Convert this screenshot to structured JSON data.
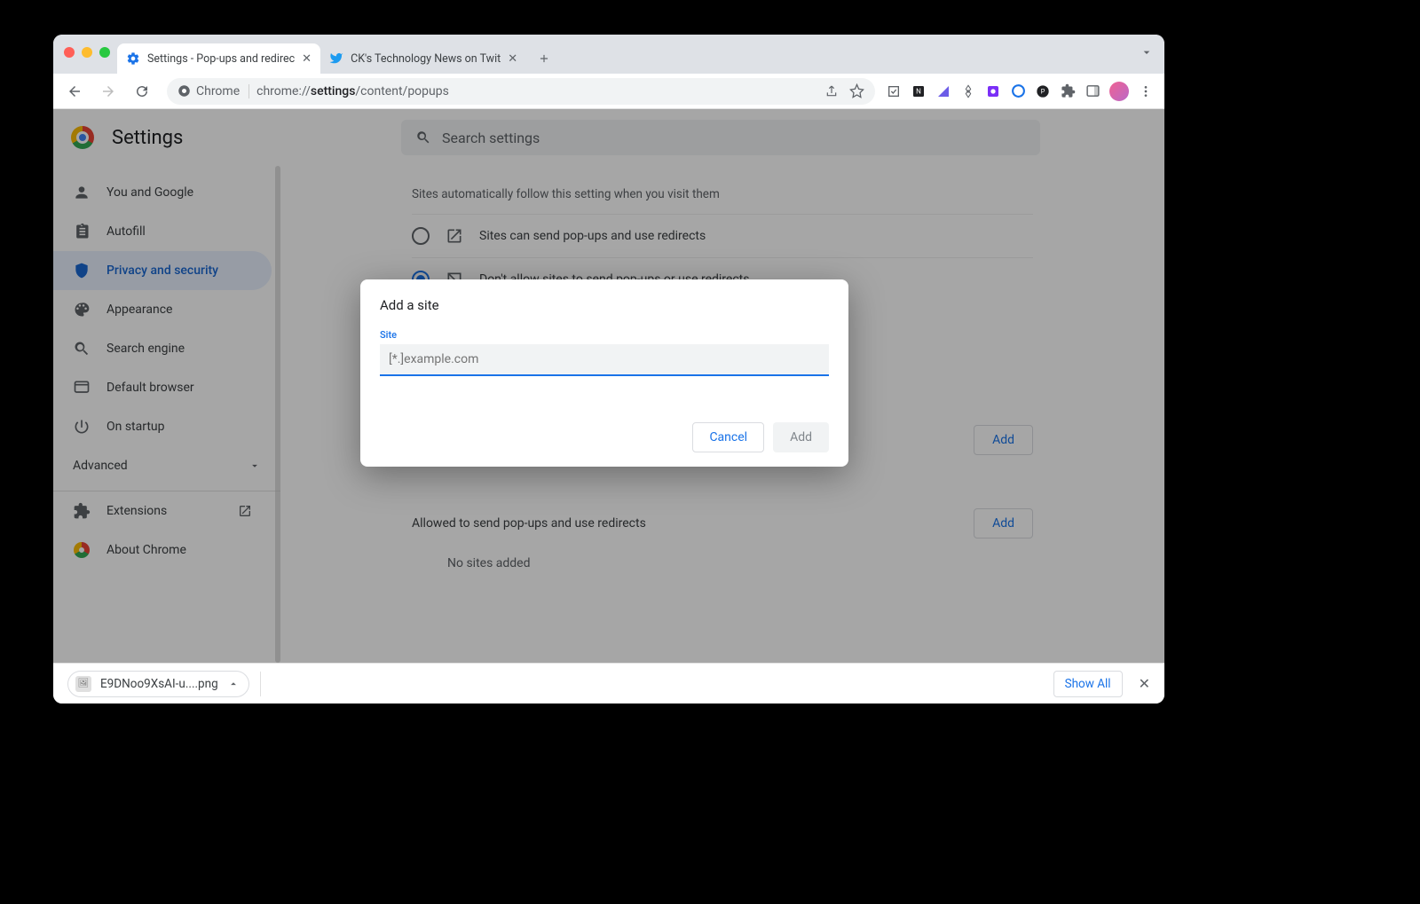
{
  "tabs": [
    {
      "title": "Settings - Pop-ups and redirec"
    },
    {
      "title": "CK's Technology News on Twit"
    }
  ],
  "omnibox": {
    "chip": "Chrome",
    "url_prefix": "chrome://",
    "url_bold": "settings",
    "url_suffix": "/content/popups"
  },
  "settings_header": {
    "title": "Settings",
    "search_placeholder": "Search settings"
  },
  "sidebar": {
    "items": [
      {
        "label": "You and Google"
      },
      {
        "label": "Autofill"
      },
      {
        "label": "Privacy and security"
      },
      {
        "label": "Appearance"
      },
      {
        "label": "Search engine"
      },
      {
        "label": "Default browser"
      },
      {
        "label": "On startup"
      }
    ],
    "advanced": "Advanced",
    "footer": [
      {
        "label": "Extensions"
      },
      {
        "label": "About Chrome"
      }
    ]
  },
  "panel": {
    "caption": "Sites automatically follow this setting when you visit them",
    "radio_allow": "Sites can send pop-ups and use redirects",
    "radio_block": "Don't allow sites to send pop-ups or use redirects",
    "section_allowed": "Allowed to send pop-ups and use redirects",
    "add": "Add",
    "no_sites": "No sites added"
  },
  "dialog": {
    "title": "Add a site",
    "field_label": "Site",
    "placeholder": "[*.]example.com",
    "cancel": "Cancel",
    "add": "Add"
  },
  "downloads": {
    "file": "E9DNoo9XsAI-u....png",
    "show_all": "Show All"
  }
}
